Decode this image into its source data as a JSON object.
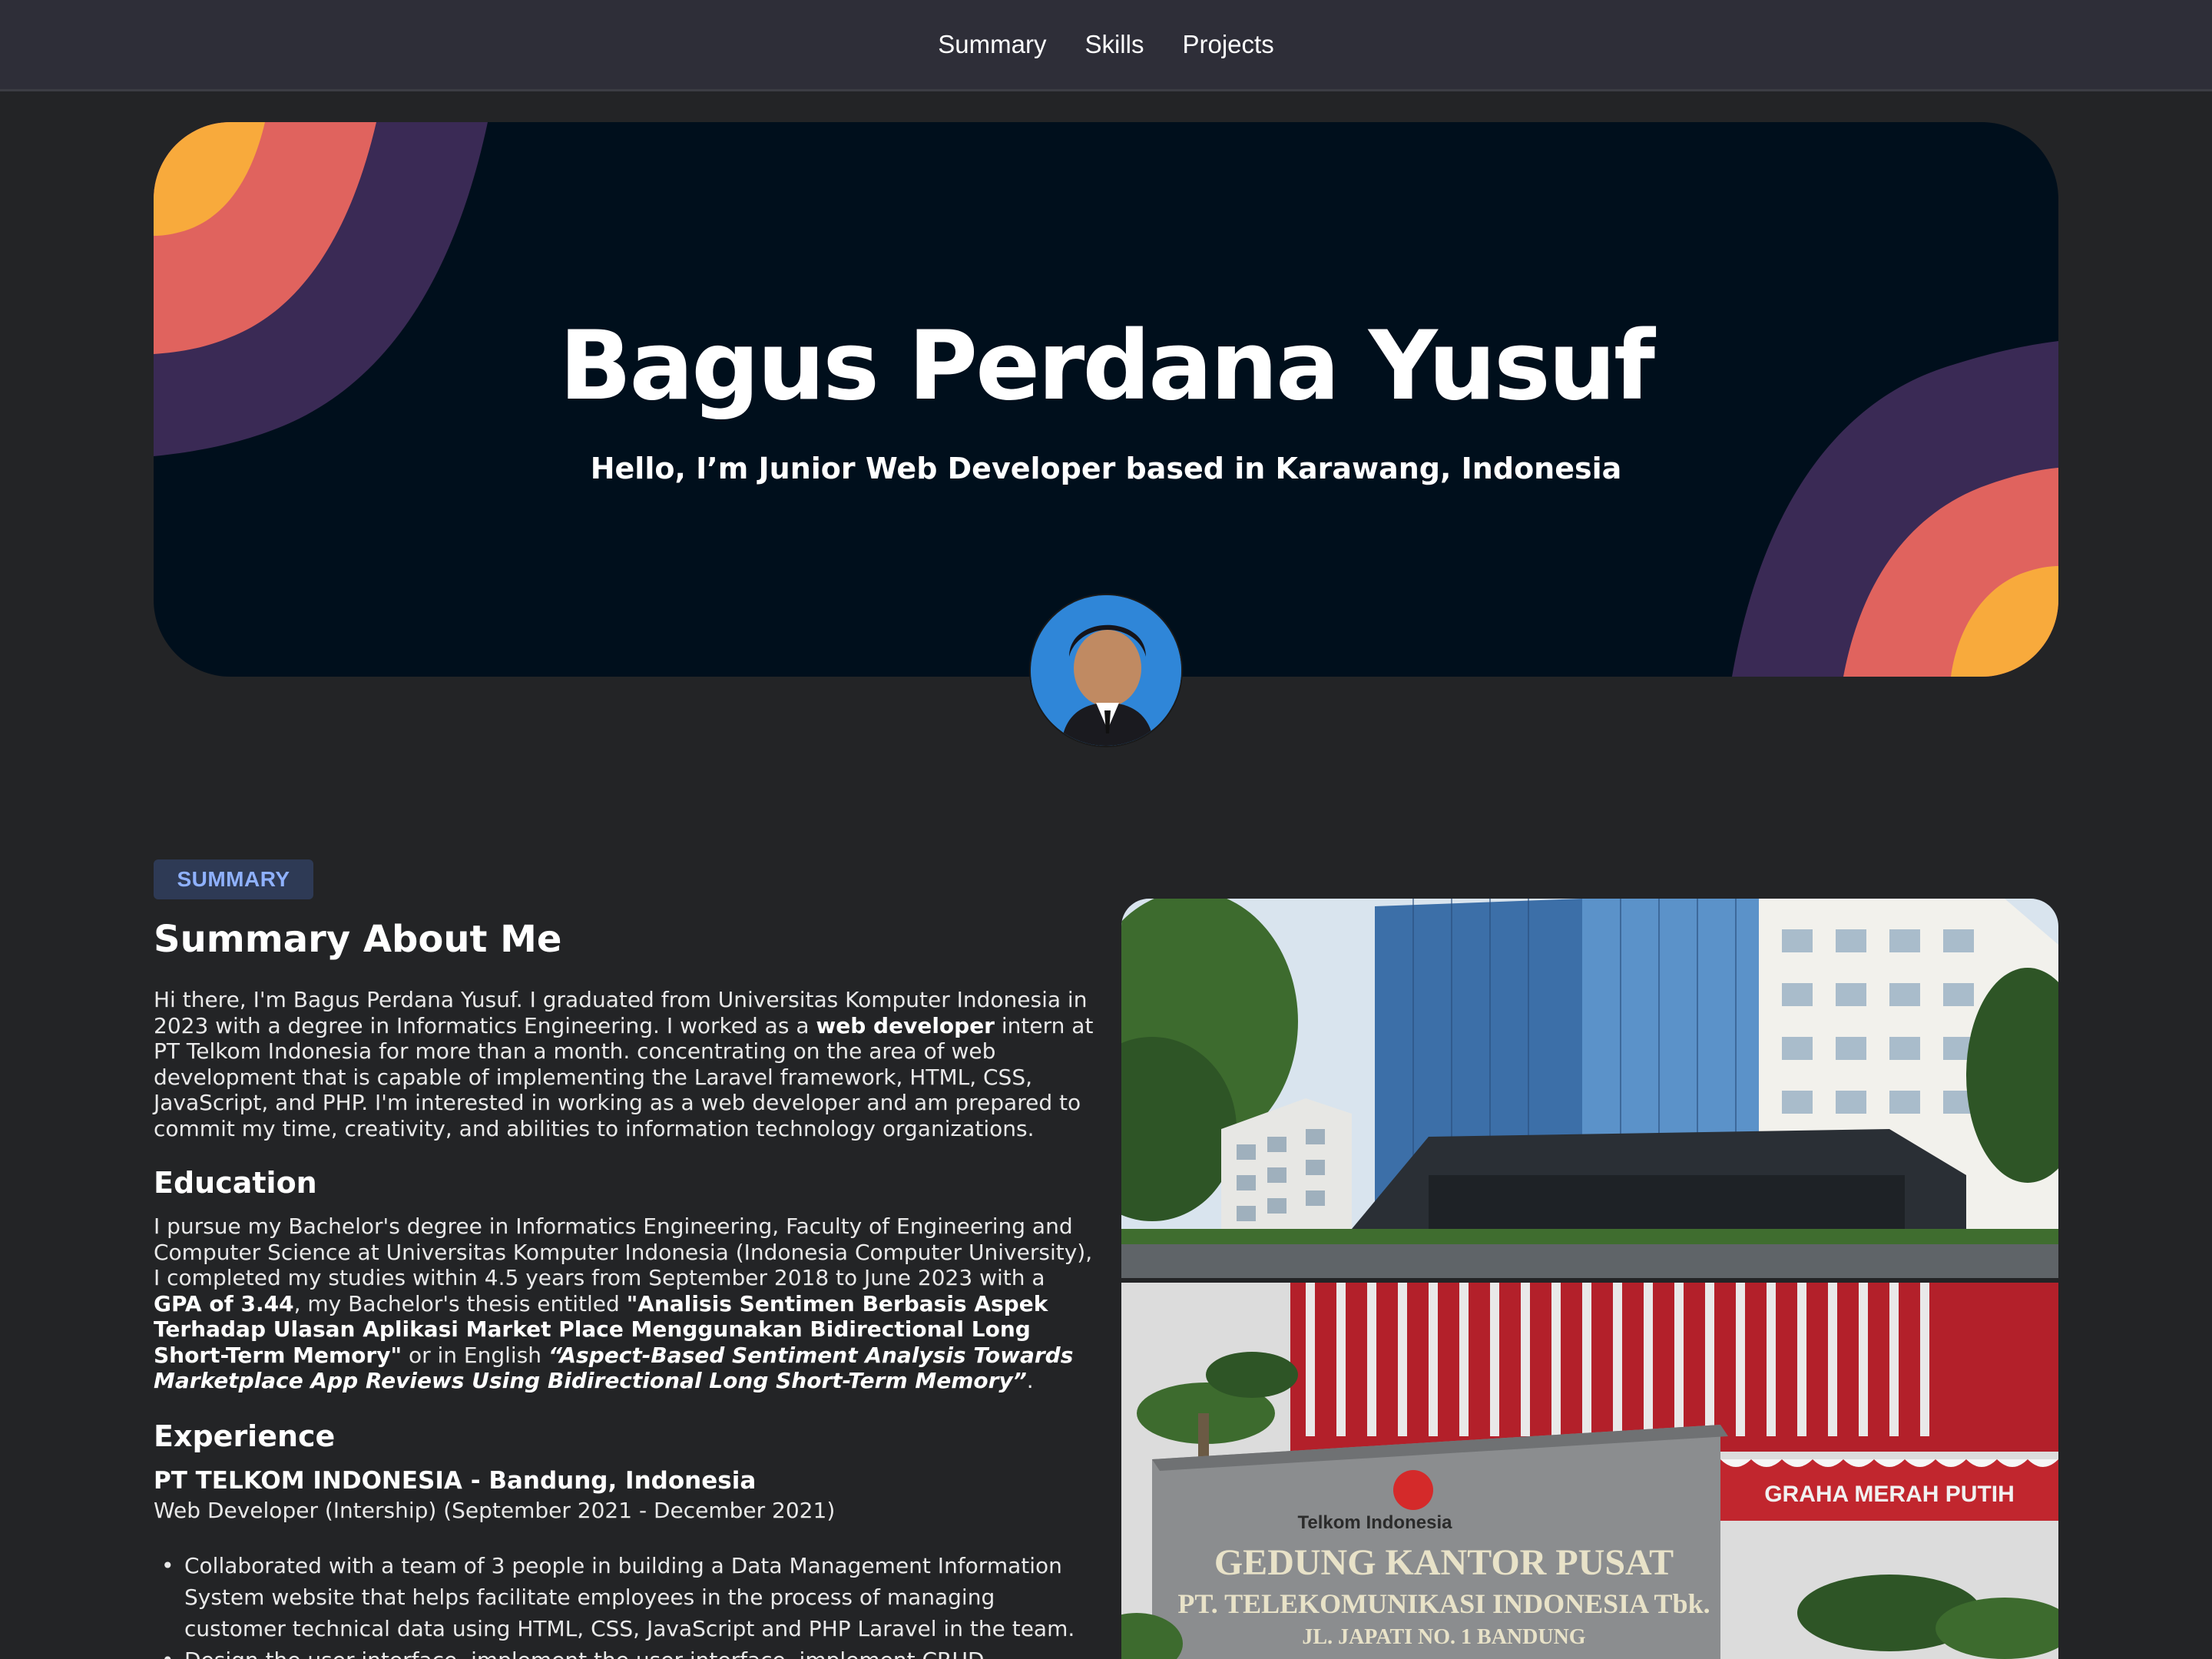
{
  "nav": {
    "items": [
      {
        "label": "Summary"
      },
      {
        "label": "Skills"
      },
      {
        "label": "Projects"
      }
    ]
  },
  "hero": {
    "title": "Bagus Perdana Yusuf",
    "subtitle": "Hello, I’m Junior Web Developer based in Karawang, Indonesia",
    "colors": {
      "background": "#000f1c",
      "purple": "#3a2a55",
      "coral": "#e0635e",
      "orange": "#f8aa3c"
    }
  },
  "summary": {
    "badge": "SUMMARY",
    "heading": "Summary About Me",
    "about": {
      "p1": "Hi there, I'm Bagus Perdana Yusuf. I graduated from Universitas Komputer Indonesia in 2023 with a degree in Informatics Engineering. I worked as a ",
      "bold1": "web developer",
      "p2": " intern at PT Telkom Indonesia for more than a month. concentrating on the area of web development that is capable of implementing the Laravel framework, HTML, CSS, JavaScript, and PHP. I'm interested in working as a web developer and am prepared to commit my time, creativity, and abilities to information technology organizations."
    },
    "education": {
      "heading": "Education",
      "p1": "I pursue my Bachelor's degree in Informatics Engineering, Faculty of Engineering and Computer Science at Universitas Komputer Indonesia (Indonesia Computer University), I completed my studies within 4.5 years from September 2018 to June 2023 with a ",
      "gpa": "GPA of 3.44",
      "p2": ", my Bachelor's thesis entitled ",
      "thesis_id": "\"Analisis Sentimen Berbasis Aspek Terhadap Ulasan Aplikasi Market Place Menggunakan Bidirectional Long Short-Term Memory\"",
      "p3": " or in English ",
      "thesis_en": "“Aspect-Based Sentiment Analysis Towards Marketplace App Reviews Using Bidirectional Long Short-Term Memory”",
      "p4": "."
    },
    "experience": {
      "heading": "Experience",
      "company": "PT TELKOM INDONESIA - Bandung, Indonesia",
      "role": "Web Developer (Intership) (September 2021 - December 2021)",
      "bullets": [
        "Collaborated with a team of 3 people in building a Data Management Information System website that helps facilitate employees in the process of managing customer technical data using HTML, CSS, JavaScript and PHP Laravel in the team.",
        "Design the user interface, implement the user interface, implement CRUD operations"
      ]
    },
    "photos": {
      "building_sign": "GEDUNG KANTOR PUSAT",
      "building_sign2": "PT. TELEKOMUNIKASI INDONESIA Tbk.",
      "building_sign3": "JL. JAPATI NO. 1 BANDUNG",
      "logo_text": "Telkom Indonesia",
      "banner": "GRAHA MERAH PUTIH"
    }
  }
}
